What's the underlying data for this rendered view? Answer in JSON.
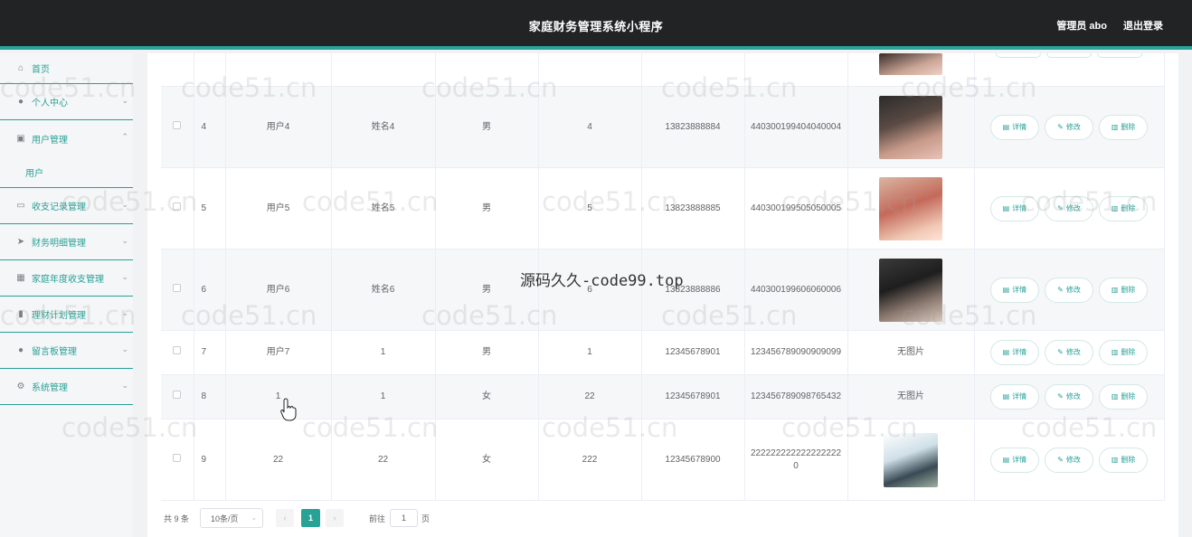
{
  "header": {
    "title": "家庭财务管理系统小程序",
    "admin_label": "管理员 abo",
    "logout_label": "退出登录"
  },
  "sidebar": {
    "items": [
      {
        "label": "首页",
        "icon": "home-icon"
      },
      {
        "label": "个人中心",
        "icon": "user-icon"
      },
      {
        "label": "用户管理",
        "icon": "user-manage-icon",
        "sub": "用户"
      },
      {
        "label": "收支记录管理",
        "icon": "chat-icon"
      },
      {
        "label": "财务明细管理",
        "icon": "send-icon"
      },
      {
        "label": "家庭年度收支管理",
        "icon": "grid-icon"
      },
      {
        "label": "理财计划管理",
        "icon": "bar-chart-icon"
      },
      {
        "label": "留言板管理",
        "icon": "bulb-icon"
      },
      {
        "label": "系统管理",
        "icon": "settings-icon"
      }
    ]
  },
  "table": {
    "rows": [
      {
        "id": "4",
        "username": "用户4",
        "name": "姓名4",
        "gender": "男",
        "age": "4",
        "phone": "13823888884",
        "idcard": "440300199404040004",
        "photo": "avatar-photo"
      },
      {
        "id": "5",
        "username": "用户5",
        "name": "姓名5",
        "gender": "男",
        "age": "5",
        "phone": "13823888885",
        "idcard": "440300199505050005",
        "photo": "avatar-photo"
      },
      {
        "id": "6",
        "username": "用户6",
        "name": "姓名6",
        "gender": "男",
        "age": "6",
        "phone": "13823888886",
        "idcard": "440300199606060006",
        "photo": "avatar-photo"
      },
      {
        "id": "7",
        "username": "用户7",
        "name": "1",
        "gender": "男",
        "age": "1",
        "phone": "12345678901",
        "idcard": "123456789090909099",
        "photo_text": "无图片"
      },
      {
        "id": "8",
        "username": "1",
        "name": "1",
        "gender": "女",
        "age": "22",
        "phone": "12345678901",
        "idcard": "123456789098765432",
        "photo_text": "无图片"
      },
      {
        "id": "9",
        "username": "22",
        "name": "22",
        "gender": "女",
        "age": "222",
        "phone": "12345678900",
        "idcard": "2222222222222222220",
        "photo": "avatar-photo"
      }
    ],
    "actions": {
      "detail": "详情",
      "edit": "修改",
      "delete": "删除"
    }
  },
  "pagination": {
    "total_label": "共 9 条",
    "page_size": "10条/页",
    "current_page": "1",
    "goto_label": "前往",
    "goto_value": "1",
    "goto_suffix": "页"
  },
  "watermark": {
    "text": "code51.cn",
    "center_text": "源码久久-code99.top"
  }
}
